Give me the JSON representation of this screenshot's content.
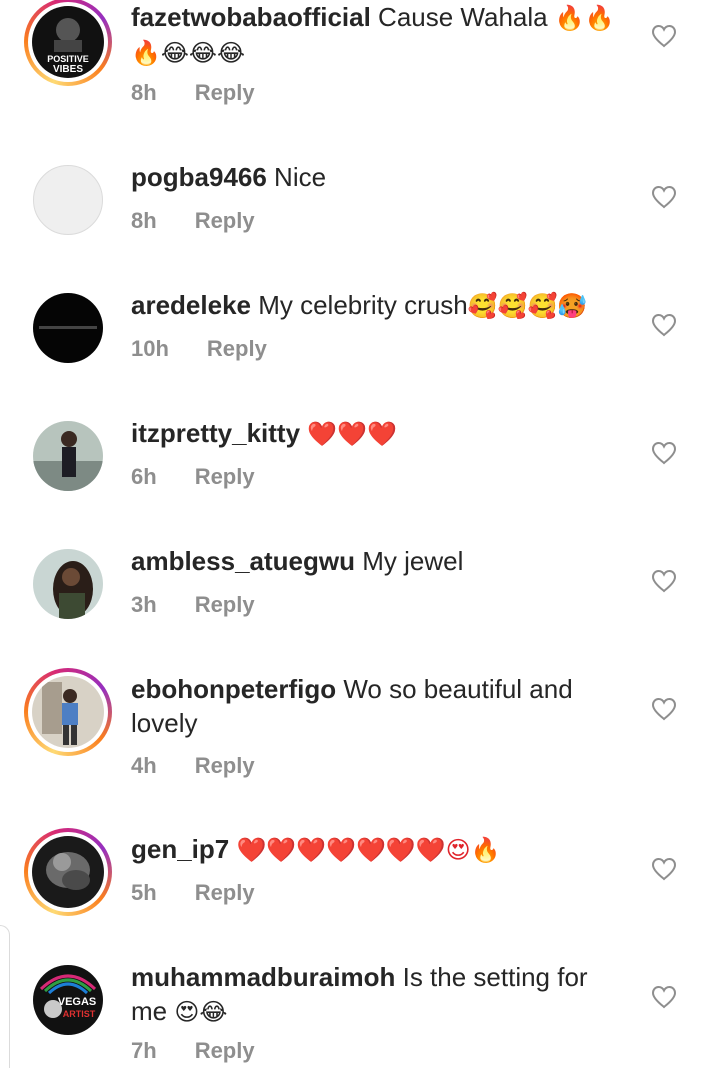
{
  "comments": [
    {
      "username": "fazetwobabaofficial",
      "text": " Cause Wahala ",
      "emojis": "🔥🔥🔥😂😂😂",
      "time": "8h",
      "reply_label": "Reply",
      "avatar_text_1": "POSITIVE",
      "avatar_text_2": "VIBES"
    },
    {
      "username": "pogba9466",
      "text": " Nice",
      "emojis": "",
      "time": "8h",
      "reply_label": "Reply"
    },
    {
      "username": "aredeleke",
      "text": " My celebrity crush",
      "emojis": "🥰🥰🥰🥵",
      "time": "10h",
      "reply_label": "Reply"
    },
    {
      "username": "itzpretty_kitty",
      "text": " ",
      "emojis": "❤️❤️❤️",
      "time": "6h",
      "reply_label": "Reply"
    },
    {
      "username": "ambless_atuegwu",
      "text": " My jewel",
      "emojis": "",
      "time": "3h",
      "reply_label": "Reply"
    },
    {
      "username": "ebohonpeterfigo",
      "text": " Wo so beautiful and lovely",
      "emojis": "",
      "time": "4h",
      "reply_label": "Reply"
    },
    {
      "username": "gen_ip7",
      "text": " ",
      "emojis": "❤️❤️❤️❤️❤️❤️❤️😍🔥",
      "time": "5h",
      "reply_label": "Reply"
    },
    {
      "username": "muhammadburaimoh",
      "text": " Is the setting for me ",
      "emojis": "😍😂",
      "time": "7h",
      "reply_label": "Reply",
      "avatar_text_1": "VEGAS",
      "avatar_text_2": "ARTIST"
    }
  ],
  "colors": {
    "text": "#262626",
    "meta": "#8e8e8e",
    "heart_outline": "#8e8e8e"
  },
  "icons": {
    "like": "heart-outline-icon"
  }
}
